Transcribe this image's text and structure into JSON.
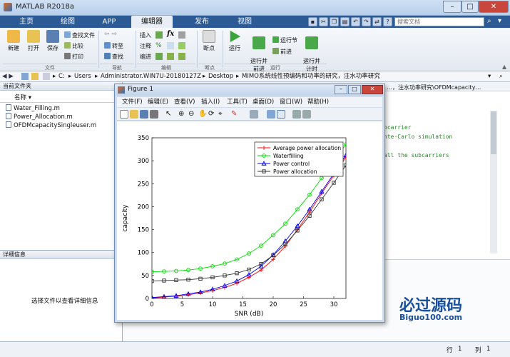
{
  "window": {
    "title": "MATLAB R2018a",
    "min": "–",
    "max": "□",
    "close": "✕"
  },
  "ribbon_tabs": [
    "主页",
    "绘图",
    "APP",
    "编辑器",
    "发布",
    "视图"
  ],
  "search": {
    "placeholder": "搜索文档"
  },
  "ribbon": {
    "new": "新建",
    "open": "打开",
    "save": "保存",
    "find_files": "查找文件",
    "compare": "比较",
    "print": "打印",
    "goto": "转至",
    "find": "查找",
    "insert": "插入",
    "comment": "注释",
    "indent": "缩进",
    "fx": "fx",
    "breakpoint": "断点",
    "run": "运行",
    "run_advance": "运行并\n前进",
    "run_section": "运行节",
    "advance": "前进",
    "run_time": "运行并\n计时",
    "groups": {
      "file": "文件",
      "nav": "导航",
      "edit": "编辑",
      "bp": "断点",
      "run": "运行"
    }
  },
  "path": {
    "items": [
      "C:",
      "Users",
      "Administrator.WIN7U-20180127Z",
      "Desktop",
      "MIMO系统线性预编码和功率的研究，注水功率研究"
    ]
  },
  "left_panel": {
    "header": "当前文件夹",
    "col_name": "名称",
    "files": [
      "Water_Filling.m",
      "Power_Allocation.m",
      "OFDMcapacitySingleuser.m"
    ]
  },
  "detail_panel": {
    "header": "详细信息",
    "message": "选择文件以查看详细信息"
  },
  "editor": {
    "tab_path": "…，注水功率研究\\OFDMcapacity…",
    "lines": [
      "ocarrier",
      "nte-Carlo simulation",
      "all the subcarriers"
    ]
  },
  "status": {
    "row_label": "行",
    "row": "1",
    "col_label": "列",
    "col": "1"
  },
  "watermark": {
    "text": "必过源码",
    "url": "Biguo100.com"
  },
  "figure": {
    "title": "Figure 1",
    "menus": [
      "文件(F)",
      "编辑(E)",
      "查看(V)",
      "插入(I)",
      "工具(T)",
      "桌面(D)",
      "窗口(W)",
      "帮助(H)"
    ]
  },
  "chart_data": {
    "type": "line",
    "xlabel": "SNR (dB)",
    "ylabel": "capacity",
    "xlim": [
      0,
      32
    ],
    "ylim": [
      0,
      350
    ],
    "xticks": [
      0,
      5,
      10,
      15,
      20,
      25,
      30
    ],
    "yticks": [
      0,
      50,
      100,
      150,
      200,
      250,
      300,
      350
    ],
    "grid": false,
    "legend_position": "top-right",
    "series": [
      {
        "name": "Average power allocation",
        "color": "#ff0000",
        "marker": "plus",
        "x": [
          0,
          2,
          4,
          6,
          8,
          10,
          12,
          14,
          16,
          18,
          20,
          22,
          24,
          26,
          28,
          30,
          32
        ],
        "y": [
          1,
          3,
          5,
          8,
          12,
          17,
          24,
          33,
          46,
          62,
          85,
          114,
          150,
          188,
          229,
          268,
          308
        ]
      },
      {
        "name": "Waterfilling",
        "color": "#00dd00",
        "marker": "circle",
        "x": [
          0,
          2,
          4,
          6,
          8,
          10,
          12,
          14,
          16,
          18,
          20,
          22,
          24,
          26,
          28,
          30,
          32
        ],
        "y": [
          58,
          59,
          60,
          62,
          65,
          70,
          76,
          85,
          98,
          115,
          138,
          163,
          194,
          226,
          262,
          298,
          336
        ]
      },
      {
        "name": "Power control",
        "color": "#0000ee",
        "marker": "triangle",
        "x": [
          0,
          2,
          4,
          6,
          8,
          10,
          12,
          14,
          16,
          18,
          20,
          22,
          24,
          26,
          28,
          30,
          32
        ],
        "y": [
          2,
          4,
          6,
          10,
          14,
          20,
          28,
          38,
          52,
          70,
          95,
          125,
          158,
          194,
          233,
          272,
          312
        ]
      },
      {
        "name": "Power allocation",
        "color": "#333333",
        "marker": "square",
        "x": [
          0,
          2,
          4,
          6,
          8,
          10,
          12,
          14,
          16,
          18,
          20,
          22,
          24,
          26,
          28,
          30,
          32
        ],
        "y": [
          38,
          39,
          40,
          41,
          43,
          46,
          50,
          55,
          63,
          75,
          94,
          118,
          148,
          180,
          216,
          252,
          290
        ]
      }
    ]
  }
}
